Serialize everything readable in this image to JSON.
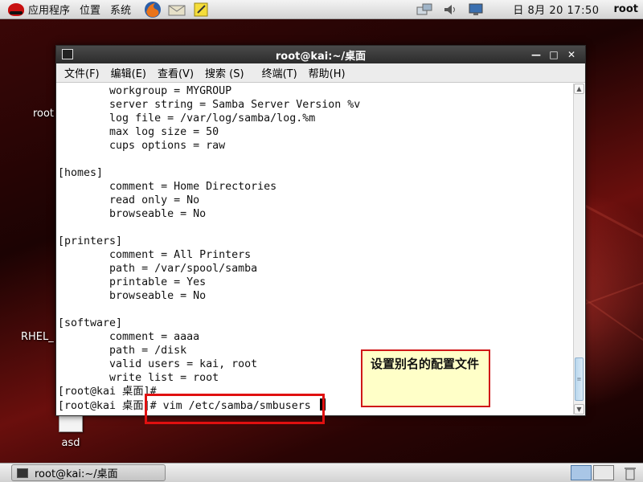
{
  "top_panel": {
    "menus": [
      "应用程序",
      "位置",
      "系统"
    ],
    "launchers": [
      "firefox-icon",
      "mail-icon",
      "notes-icon"
    ],
    "tray": [
      "network-icon",
      "volume-icon",
      "display-icon"
    ],
    "clock": "日 8月 20 17:50",
    "user": "root"
  },
  "desktop": {
    "icons": [
      {
        "label": "root"
      },
      {
        "label": "RHEL_"
      },
      {
        "label": "asd"
      }
    ]
  },
  "window": {
    "title": "root@kai:~/桌面",
    "menu": [
      "文件(F)",
      "编辑(E)",
      "查看(V)",
      "搜索 (S)",
      "终端(T)",
      "帮助(H)"
    ],
    "buttons": [
      "minimize",
      "maximize",
      "close"
    ]
  },
  "terminal": {
    "lines": [
      "        workgroup = MYGROUP",
      "        server string = Samba Server Version %v",
      "        log file = /var/log/samba/log.%m",
      "        max log size = 50",
      "        cups options = raw",
      "",
      "[homes]",
      "        comment = Home Directories",
      "        read only = No",
      "        browseable = No",
      "",
      "[printers]",
      "        comment = All Printers",
      "        path = /var/spool/samba",
      "        printable = Yes",
      "        browseable = No",
      "",
      "[software]",
      "        comment = aaaa",
      "        path = /disk",
      "        valid users = kai, root",
      "        write list = root",
      "[root@kai 桌面]#",
      "[root@kai 桌面]# vim /etc/samba/smbusers "
    ]
  },
  "annotation": {
    "callout_text": "设置别名的配置文件"
  },
  "bottom_panel": {
    "task_label": "root@kai:~/桌面"
  },
  "colors": {
    "annotation_border": "#e01010",
    "callout_bg": "#ffffc8",
    "titlebar": "#333333",
    "desktop": "#3a0707"
  }
}
